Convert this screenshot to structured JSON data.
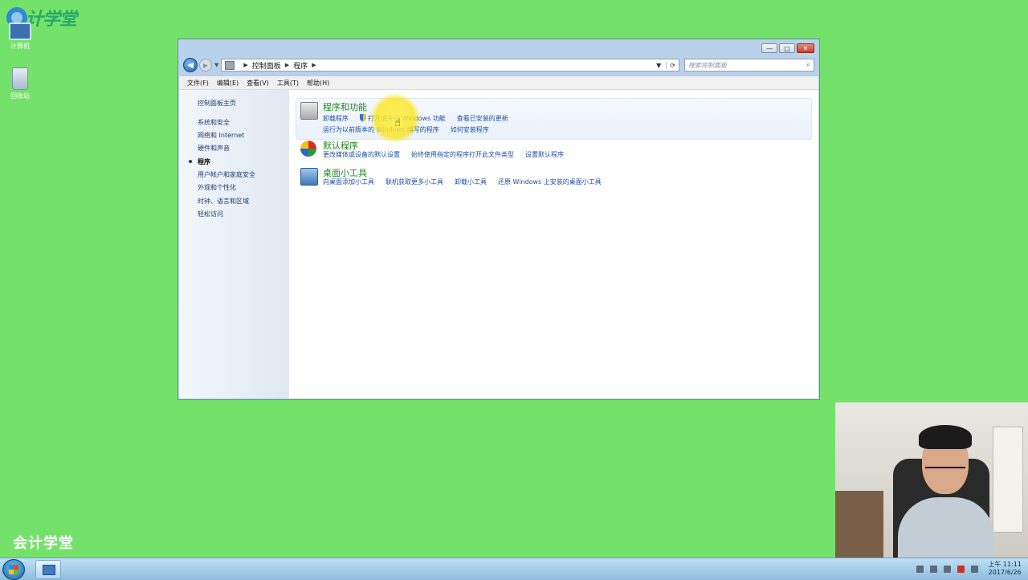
{
  "desktop": {
    "brand_logo_text": "计学堂",
    "icons": [
      {
        "label": "计算机",
        "icon": "computer-icon"
      },
      {
        "label": "回收站",
        "icon": "recycle-bin-icon"
      }
    ],
    "watermark": "会计学堂"
  },
  "window": {
    "controls": {
      "minimize": "—",
      "maximize": "□",
      "close": "✕"
    },
    "breadcrumb": [
      "控制面板",
      "程序"
    ],
    "search_placeholder": "搜索控制面板",
    "menu": [
      "文件(F)",
      "编辑(E)",
      "查看(V)",
      "工具(T)",
      "帮助(H)"
    ],
    "sidebar": {
      "home": "控制面板主页",
      "items": [
        {
          "label": "系统和安全",
          "active": false
        },
        {
          "label": "网络和 Internet",
          "active": false
        },
        {
          "label": "硬件和声音",
          "active": false
        },
        {
          "label": "程序",
          "active": true
        },
        {
          "label": "用户帐户和家庭安全",
          "active": false
        },
        {
          "label": "外观和个性化",
          "active": false
        },
        {
          "label": "时钟、语言和区域",
          "active": false
        },
        {
          "label": "轻松访问",
          "active": false
        }
      ]
    },
    "categories": [
      {
        "title": "程序和功能",
        "icon": "programs-icon",
        "links_line1": [
          "卸载程序",
          "打开或关闭 Windows 功能",
          "查看已安装的更新"
        ],
        "links_line2": [
          "运行为以前版本的 Windows 编写的程序",
          "如何安装程序"
        ]
      },
      {
        "title": "默认程序",
        "icon": "default-programs-icon",
        "links_line1": [
          "更改媒体或设备的默认设置",
          "始终使用指定的程序打开此文件类型",
          "设置默认程序"
        ]
      },
      {
        "title": "桌面小工具",
        "icon": "gadgets-icon",
        "links_line1": [
          "向桌面添加小工具",
          "联机获取更多小工具",
          "卸载小工具",
          "还原 Windows 上安装的桌面小工具"
        ]
      }
    ]
  },
  "taskbar": {
    "clock_time": "上午 11:11",
    "clock_date": "2017/6/26"
  },
  "colors": {
    "desktop_bg": "#74e26a",
    "link": "#1c4e9e",
    "category_title": "#1e8a1e"
  }
}
